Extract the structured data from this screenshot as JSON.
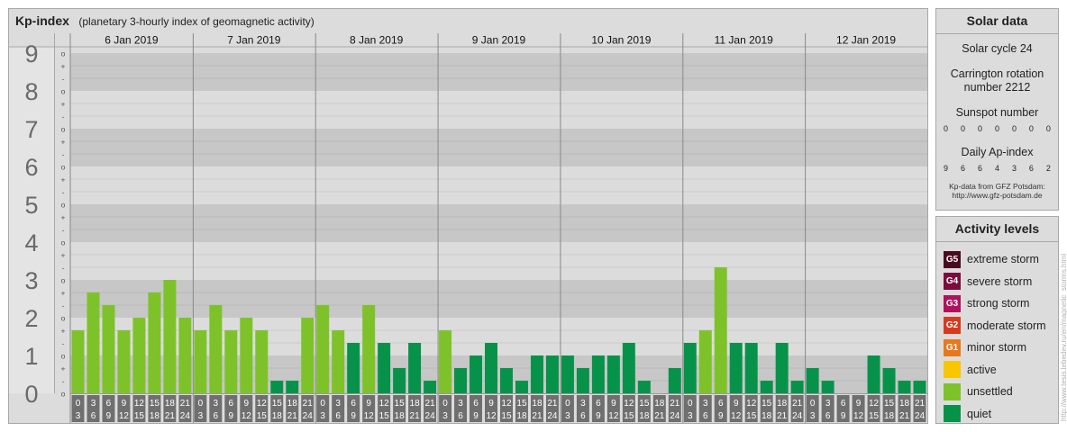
{
  "title": {
    "main": "Kp-index",
    "sub": "(planetary 3-hourly index of geomagnetic activity)"
  },
  "chart_data": {
    "type": "bar",
    "title": "Kp-index",
    "subtitle": "(planetary 3-hourly index of geomagnetic activity)",
    "ylim": [
      0,
      9
    ],
    "y_ticks": [
      "0",
      "1",
      "2",
      "3",
      "4",
      "5",
      "6",
      "7",
      "8",
      "9"
    ],
    "sub_ticks": [
      "o",
      "-",
      "+"
    ],
    "days": [
      "6 Jan 2019",
      "7 Jan 2019",
      "8 Jan 2019",
      "9 Jan 2019",
      "10 Jan 2019",
      "11 Jan 2019",
      "12 Jan 2019"
    ],
    "interval_start": [
      "0",
      "3",
      "6",
      "9",
      "12",
      "15",
      "18",
      "21"
    ],
    "interval_end": [
      "3",
      "6",
      "9",
      "12",
      "15",
      "18",
      "21",
      "24"
    ],
    "values": [
      1.667,
      2.667,
      2.333,
      1.667,
      2,
      2.667,
      3,
      2,
      1.667,
      2.333,
      1.667,
      2,
      1.667,
      0.333,
      0.333,
      2,
      2.333,
      1.667,
      1.333,
      2.333,
      1.333,
      0.667,
      1.333,
      0.333,
      1.667,
      0.667,
      1,
      1.333,
      0.667,
      0.333,
      1,
      1,
      1,
      0.667,
      1,
      1,
      1.333,
      0.333,
      0,
      0.667,
      1.333,
      1.667,
      3.333,
      1.333,
      1.333,
      0.333,
      1.333,
      0.333,
      0.667,
      0.333,
      0,
      0,
      1,
      0.667,
      0.333,
      0.333
    ],
    "grid": true,
    "legend": "right"
  },
  "solar": {
    "heading": "Solar data",
    "cycle": "Solar cycle 24",
    "carrington_1": "Carrington rotation",
    "carrington_2": "number 2212",
    "sunspot_label": "Sunspot number",
    "sunspot_values": [
      "0",
      "0",
      "0",
      "0",
      "0",
      "0",
      "0"
    ],
    "ap_label": "Daily Ap-index",
    "ap_values": [
      "9",
      "6",
      "6",
      "4",
      "3",
      "6",
      "2"
    ],
    "source_1": "Kp-data from GFZ Potsdam:",
    "source_2": "http://www.gfz-potsdam.de"
  },
  "activity": {
    "heading": "Activity levels",
    "levels": [
      {
        "badge": "G5",
        "label": "extreme storm",
        "color": "#4a0a20"
      },
      {
        "badge": "G4",
        "label": "severe storm",
        "color": "#7a0d3e"
      },
      {
        "badge": "G3",
        "label": "strong storm",
        "color": "#b0125d"
      },
      {
        "badge": "G2",
        "label": "moderate storm",
        "color": "#d83a1e"
      },
      {
        "badge": "G1",
        "label": "minor storm",
        "color": "#e8781c"
      },
      {
        "badge": "",
        "label": "active",
        "color": "#f7c600"
      },
      {
        "badge": "",
        "label": "unsettled",
        "color": "#7ec22a"
      },
      {
        "badge": "",
        "label": "quiet",
        "color": "#07924a"
      }
    ]
  },
  "watermark": "http://www.tesis.lebedev.ru/en/magnetic_storms.html",
  "colors": {
    "quiet": "#07924a",
    "unsettled": "#7ec22a",
    "active": "#f7c600",
    "band_dark": "#c7c7c7",
    "band_light": "#dcdcdc",
    "label_bg": "#6f6f6f"
  }
}
